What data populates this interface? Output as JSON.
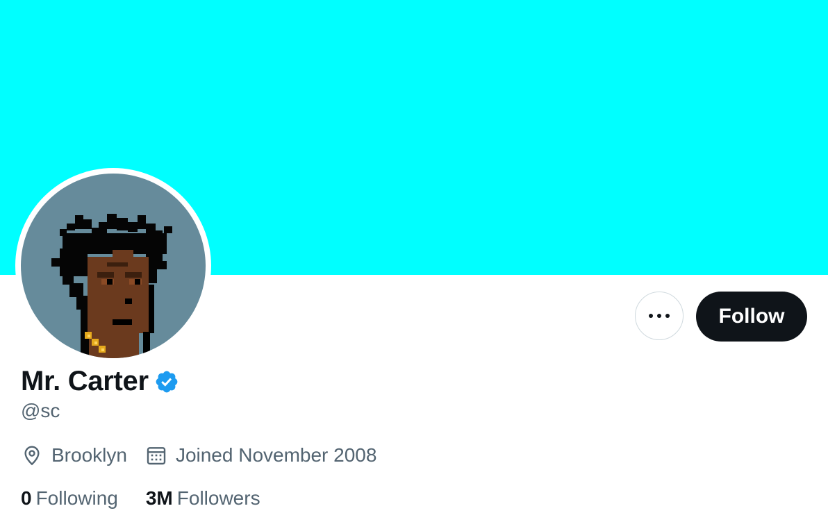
{
  "profile": {
    "banner_color": "#00ffff",
    "avatar_bg_color": "#668b9b",
    "display_name": "Mr. Carter",
    "verified": true,
    "handle": "@sc",
    "location": "Brooklyn",
    "joined": "Joined November 2008",
    "location_icon": "location-pin-icon",
    "calendar_icon": "calendar-icon"
  },
  "actions": {
    "more_icon": "more-dots-icon",
    "follow_label": "Follow"
  },
  "stats": {
    "following_count": "0",
    "following_label": "Following",
    "followers_count": "3M",
    "followers_label": "Followers"
  },
  "colors": {
    "accent": "#1d9bf0",
    "text_primary": "#0f1419",
    "text_secondary": "#536471",
    "follow_bg": "#0f1419"
  }
}
